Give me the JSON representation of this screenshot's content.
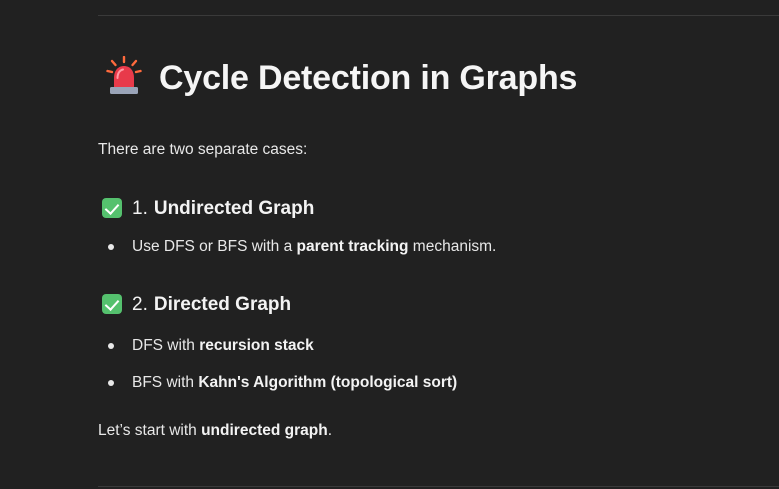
{
  "heading": {
    "icon": "police-siren-icon",
    "title": "Cycle Detection in Graphs"
  },
  "intro": "There are two separate cases:",
  "sections": [
    {
      "icon": "check-mark-button-icon",
      "number": "1.",
      "title": "Undirected Graph",
      "bullets": [
        {
          "pre": "Use DFS or BFS with a ",
          "bold": "parent tracking",
          "post": " mechanism."
        }
      ]
    },
    {
      "icon": "check-mark-button-icon",
      "number": "2.",
      "title": "Directed Graph",
      "bullets": [
        {
          "pre": "DFS with ",
          "bold": "recursion stack",
          "post": ""
        },
        {
          "pre": "BFS with ",
          "bold": "Kahn's Algorithm (topological sort)",
          "post": ""
        }
      ]
    }
  ],
  "outro": {
    "pre": "Let’s start with ",
    "bold": "undirected graph",
    "post": "."
  },
  "colors": {
    "background": "#212121",
    "text": "#ececec",
    "check_green": "#55c16e",
    "siren_red": "#e83a4a"
  }
}
